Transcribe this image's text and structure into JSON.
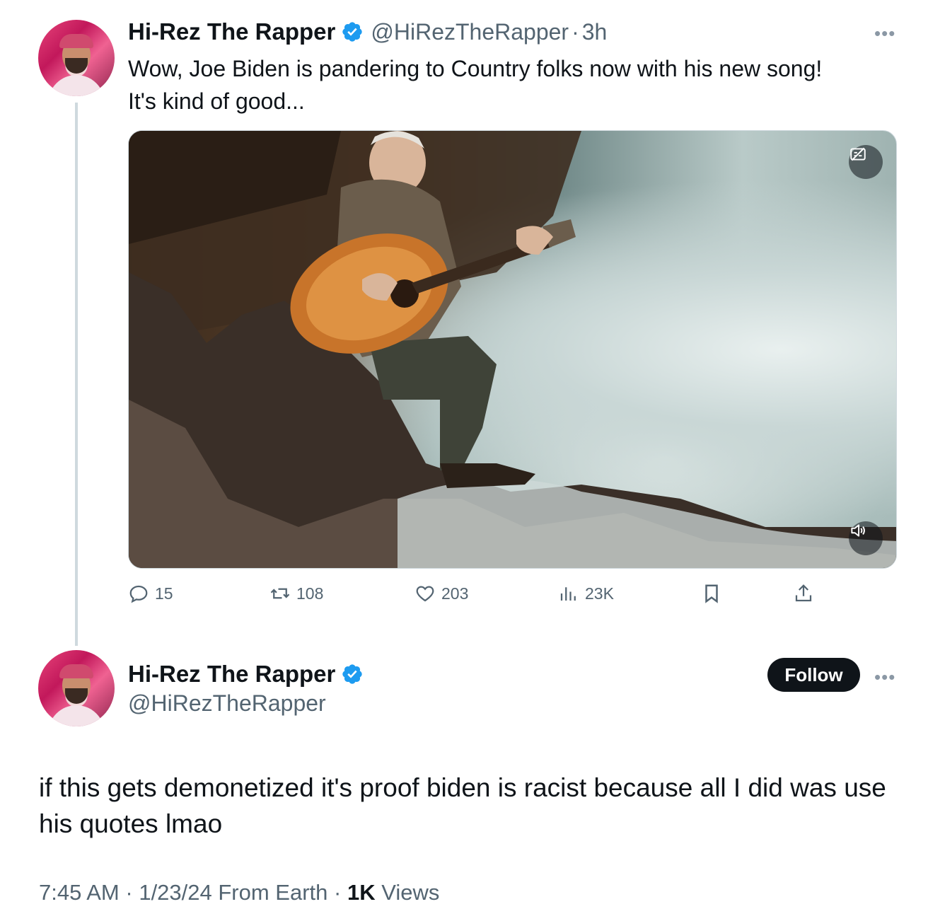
{
  "first_tweet": {
    "author": {
      "display_name": "Hi-Rez The Rapper",
      "handle": "@HiRezTheRapper",
      "avatar_icon": "avatar-photo",
      "verified_icon": "verified-badge-icon"
    },
    "separator": "·",
    "time": "3h",
    "text_line1": "Wow, Joe Biden is pandering to Country folks now with his new song!",
    "text_line2": "It's kind of good...",
    "media": {
      "type": "video",
      "top_right_icon": "captions-off-icon",
      "bottom_right_icon": "volume-icon"
    },
    "actions": {
      "replies": "15",
      "reposts": "108",
      "likes": "203",
      "views": "23K"
    }
  },
  "reply_tweet": {
    "author": {
      "display_name": "Hi-Rez The Rapper",
      "handle": "@HiRezTheRapper"
    },
    "follow_label": "Follow",
    "text": "if this gets demonetized it's proof biden is racist because all I did was use his quotes lmao",
    "meta": {
      "time": "7:45 AM",
      "sep1": "·",
      "date_source": "1/23/24 From Earth",
      "sep2": "·",
      "views_count": "1K",
      "views_label": "Views"
    }
  },
  "colors": {
    "text_primary": "#0f1419",
    "text_secondary": "#536471",
    "verified_blue": "#1d9bf0",
    "follow_bg": "#0f1419",
    "thread_line": "#cfd9de"
  }
}
